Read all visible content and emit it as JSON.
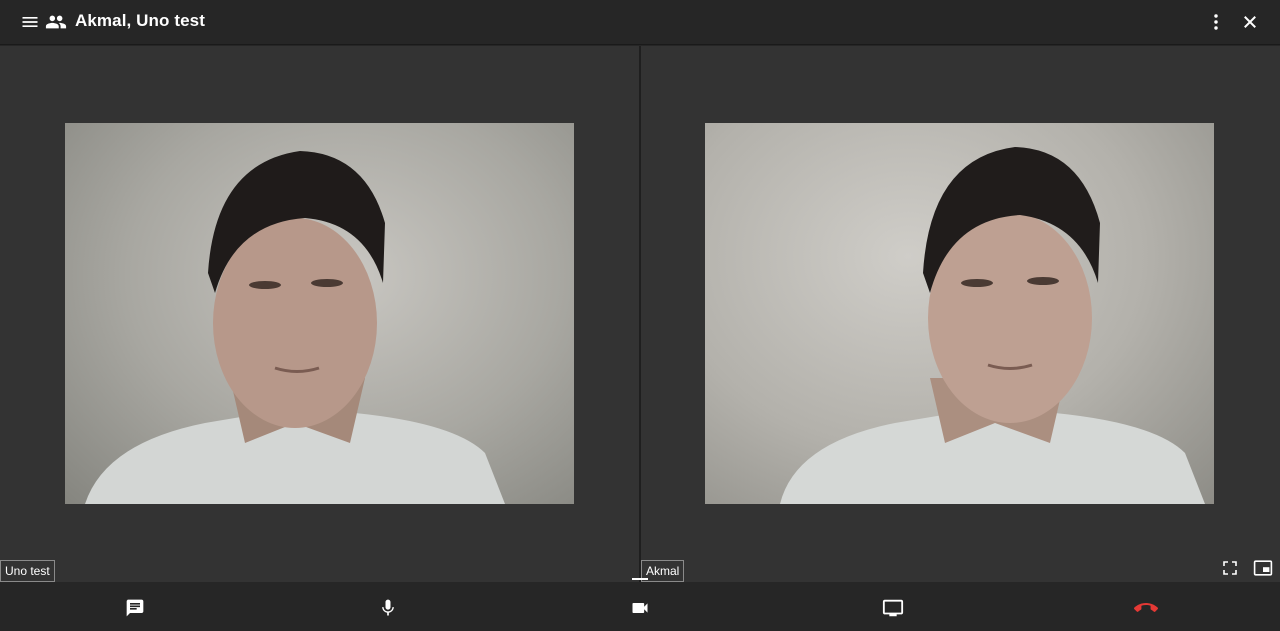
{
  "header": {
    "title": "Akmal, Uno test",
    "icons": [
      "menu-icon",
      "group-icon",
      "more-vert-icon",
      "close-icon"
    ]
  },
  "participants": [
    {
      "name": "Uno test"
    },
    {
      "name": "Akmal"
    }
  ],
  "controls": {
    "icons": [
      "chat-icon",
      "mic-icon",
      "videocam-icon",
      "screen-share-icon",
      "call-end-icon"
    ],
    "video_actions": [
      "fullscreen-icon",
      "picture-in-picture-icon"
    ]
  },
  "colors": {
    "background": "#262626",
    "stage": "#333333",
    "hangup": "#e53935"
  }
}
